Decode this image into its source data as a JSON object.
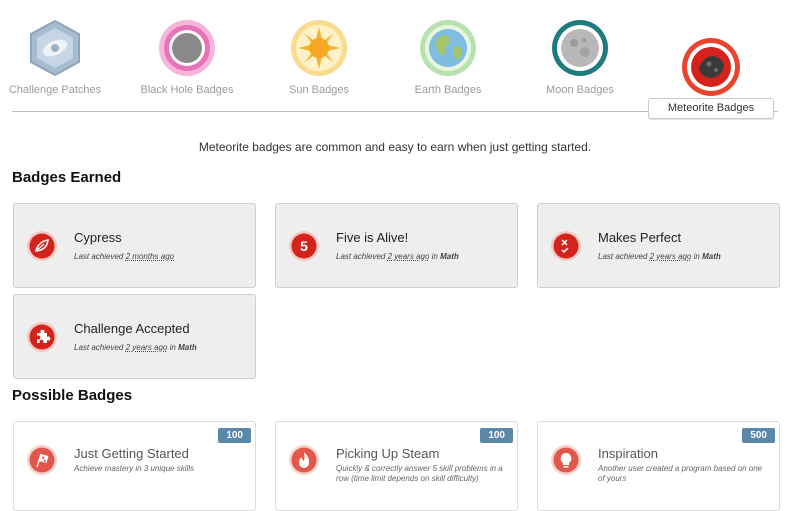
{
  "tabs": [
    {
      "label": "Challenge Patches",
      "icon": "hexagon-patch-icon"
    },
    {
      "label": "Black Hole Badges",
      "icon": "black-hole-icon"
    },
    {
      "label": "Sun Badges",
      "icon": "sun-icon"
    },
    {
      "label": "Earth Badges",
      "icon": "earth-icon"
    },
    {
      "label": "Moon Badges",
      "icon": "moon-icon"
    },
    {
      "label": "Meteorite Badges",
      "icon": "meteorite-icon",
      "active": true
    }
  ],
  "intro": "Meteorite badges are common and easy to earn when just getting started.",
  "earned": {
    "heading": "Badges Earned",
    "cards": [
      {
        "title": "Cypress",
        "prefix": "Last achieved",
        "time": "2 months ago",
        "in": "",
        "subject": "",
        "icon": "leaf-icon"
      },
      {
        "title": "Five is Alive!",
        "prefix": "Last achieved",
        "time": "2 years ago",
        "in": "in",
        "subject": "Math",
        "icon": "number-five-icon"
      },
      {
        "title": "Makes Perfect",
        "prefix": "Last achieved",
        "time": "2 years ago",
        "in": "in",
        "subject": "Math",
        "icon": "check-cross-icon"
      },
      {
        "title": "Challenge Accepted",
        "prefix": "Last achieved",
        "time": "2 years ago",
        "in": "in",
        "subject": "Math",
        "icon": "puzzle-icon"
      }
    ]
  },
  "possible": {
    "heading": "Possible Badges",
    "cards": [
      {
        "title": "Just Getting Started",
        "desc": "Achieve mastery in 3 unique skills",
        "points": "100",
        "icon": "checkered-flag-icon"
      },
      {
        "title": "Picking Up Steam",
        "desc": "Quickly & correctly answer 5 skill problems in a row (time limit depends on skill difficulty)",
        "points": "100",
        "icon": "flame-icon"
      },
      {
        "title": "Inspiration",
        "desc": "Another user created a program based on one of yours",
        "points": "500",
        "icon": "lightbulb-icon"
      }
    ]
  },
  "colors": {
    "badge_red": "#d4221c",
    "points_blue": "#5b87a8"
  }
}
